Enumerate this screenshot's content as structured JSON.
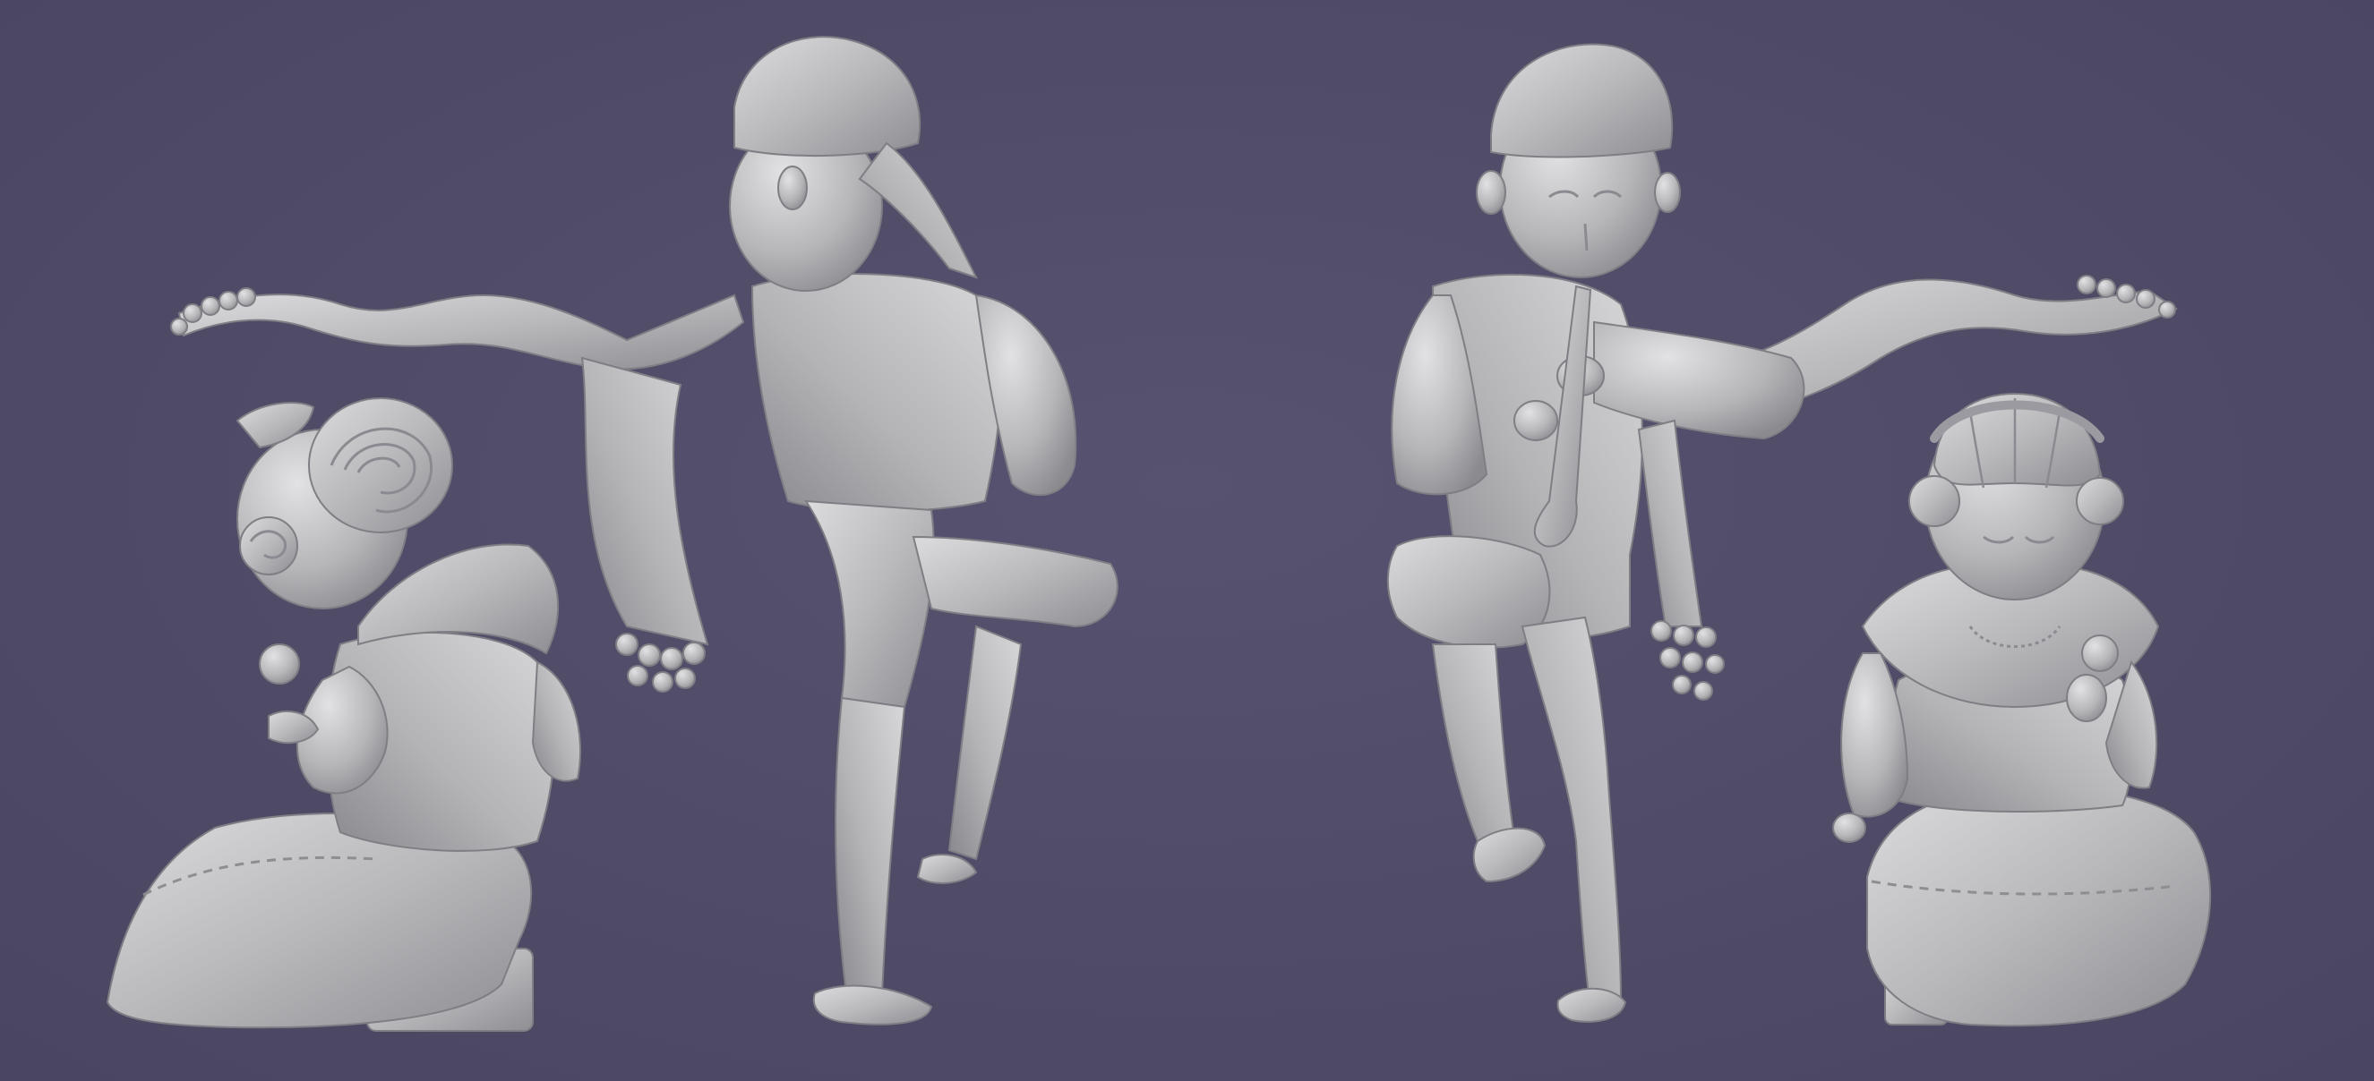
{
  "scene": {
    "background_color": "#504c68",
    "clay_color": "#bcbcbe",
    "figures": [
      {
        "name": "seated-girl-back-view",
        "props": [
          "apple",
          "stool"
        ]
      },
      {
        "name": "dancing-boy-back-view",
        "props": [
          "scarf",
          "bandana"
        ]
      },
      {
        "name": "dancing-boy-front-view",
        "props": [
          "flute",
          "scarf",
          "bandana"
        ]
      },
      {
        "name": "seated-girl-front-view",
        "props": [
          "apple",
          "stool"
        ]
      }
    ]
  }
}
